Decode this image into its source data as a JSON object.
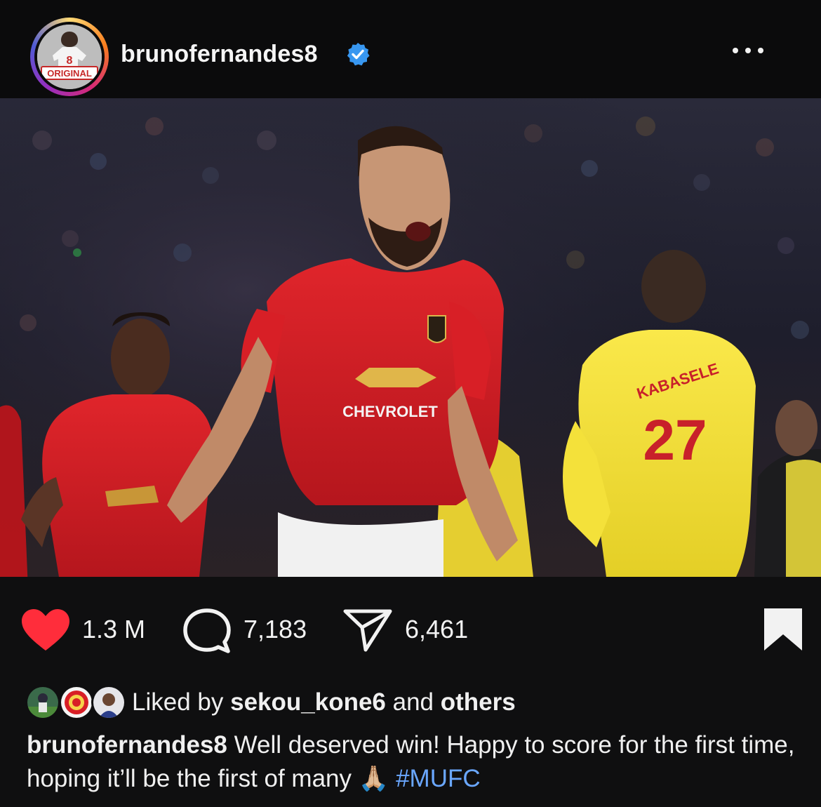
{
  "post": {
    "username": "brunofernandes8",
    "avatar_badge_text": "ORIGINAL",
    "avatar_jersey_number": "8",
    "verified": true,
    "more_icon": "more-dots-icon"
  },
  "photo": {
    "jersey_sponsor": "CHEVROLET",
    "opponent_name": "KABASELE",
    "opponent_number": "27"
  },
  "actions": {
    "likes": "1.3 M",
    "comments": "7,183",
    "shares": "6,461",
    "like_icon": "heart-filled-icon",
    "comment_icon": "comment-bubble-icon",
    "share_icon": "send-paper-plane-icon",
    "save_icon": "bookmark-filled-icon",
    "like_color": "#ff2d3b"
  },
  "likes_row": {
    "prefix": "Liked by",
    "user": "sekou_kone6",
    "middle": "and",
    "others": "others"
  },
  "caption": {
    "user": "brunofernandes8",
    "text": "Well deserved win! Happy to score for the first time, hoping it’ll be the first of many",
    "emoji": "🙏🏼",
    "hashtag": "#MUFC"
  },
  "colors": {
    "background": "#0f0f10",
    "hashtag": "#6aa7ff",
    "verified_badge": "#3897f0"
  }
}
